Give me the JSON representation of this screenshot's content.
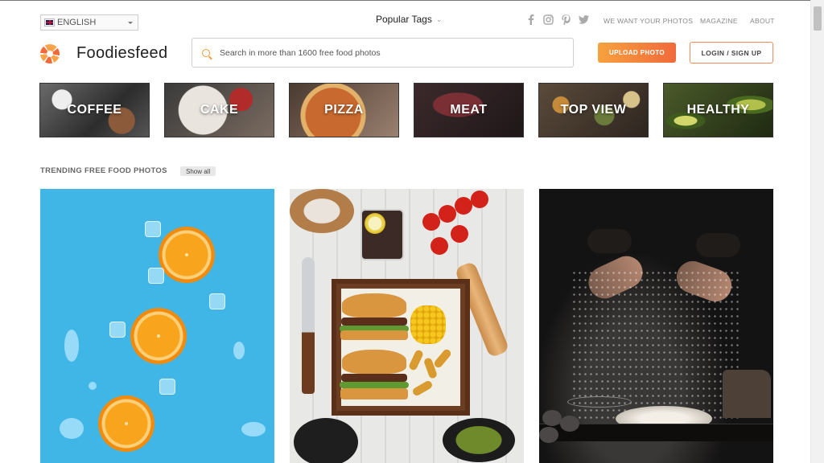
{
  "header": {
    "language": "ENGLISH",
    "popular_tags": "Popular Tags",
    "nav": [
      "WE WANT YOUR PHOTOS",
      "MAGAZINE",
      "ABOUT"
    ],
    "socials": [
      "facebook-icon",
      "instagram-icon",
      "pinterest-icon",
      "twitter-icon"
    ],
    "logo_text": "Foodiesfeed",
    "search_placeholder": "Search in more than 1600 free food photos",
    "upload_label": "UPLOAD PHOTO",
    "login_label": "LOGIN / SIGN UP"
  },
  "categories": [
    "COFFEE",
    "CAKE",
    "PIZZA",
    "MEAT",
    "TOP VIEW",
    "HEALTHY"
  ],
  "trending": {
    "title": "TRENDING FREE FOOD PHOTOS",
    "show_all": "Show all"
  },
  "colors": {
    "accent_orange": "#f39b3b",
    "upload_gradient_start": "#f7a13e",
    "upload_gradient_end": "#f16a3c"
  }
}
